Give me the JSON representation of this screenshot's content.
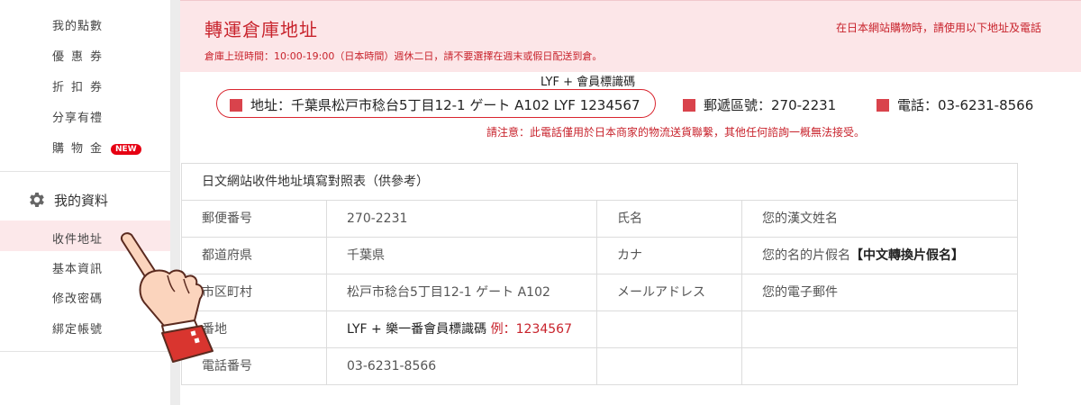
{
  "sidebar": {
    "items_top": [
      "我的點數",
      "優惠券",
      "折扣券",
      "分享有禮",
      "購物金"
    ],
    "new_badge": "NEW",
    "section_title": "我的資料",
    "items_bottom": [
      "收件地址",
      "基本資訊",
      "修改密碼",
      "綁定帳號"
    ]
  },
  "header": {
    "title": "轉運倉庫地址",
    "hours_note": "倉庫上班時間：10:00-19:00（日本時間）週休二日，請不要選擇在週末或假日配送到倉。",
    "right_note": "在日本網站購物時，請使用以下地址及電話"
  },
  "address": {
    "lyf_label": "LYF + 會員標識碼",
    "address_text": "地址：千葉県松戸市稔台5丁目12-1 ゲート A102 LYF 1234567",
    "postal_text": "郵遞區號：270-2231",
    "phone_text": "電話：03-6231-8566",
    "warning": "請注意：此電話僅用於日本商家的物流送貨聯繫，其他任何諮詢一概無法接受。"
  },
  "table": {
    "heading": "日文網站收件地址填寫對照表（供參考）",
    "rows": [
      {
        "k1": "郵便番号",
        "v1": "270-2231",
        "k2": "氏名",
        "v2": "您的漢文姓名"
      },
      {
        "k1": "都道府県",
        "v1": "千葉県",
        "k2": "カナ",
        "v2": "您的名的片假名",
        "v2_bold": "【中文轉換片假名】"
      },
      {
        "k1": "市区町村",
        "v1": "松戸市稔台5丁目12-1 ゲート A102",
        "k2": "メールアドレス",
        "v2": "您的電子郵件"
      },
      {
        "k1": "番地",
        "v1": "LYF + 樂一番會員標識碼",
        "v1_example": "例：1234567",
        "k2": "",
        "v2": ""
      },
      {
        "k1": "電話番号",
        "v1": "03-6231-8566",
        "k2": "",
        "v2": ""
      }
    ]
  },
  "colors": {
    "accent": "#c8232c",
    "header_bg": "#fce6e8",
    "active_bg": "#fce8ea"
  },
  "icons": {
    "settings": "gear-icon",
    "pointer": "pointing-hand-icon"
  }
}
